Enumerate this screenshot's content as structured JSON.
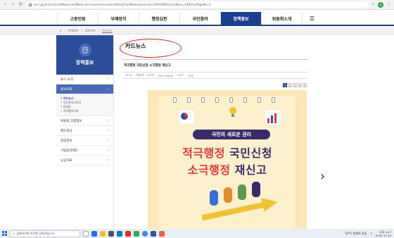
{
  "browser": {
    "url": "acrc.go.kr/acrc/cardNews/cardNews.do?command=searchDetailCardNews&menuId=050509055cardNum=1493curPageNo=1",
    "avatar_letter": "s"
  },
  "topnav": {
    "items": [
      "고충민원",
      "부패방지",
      "행정심판",
      "국민참여",
      "정책홍보",
      "위원회소개"
    ],
    "active": "정책홍보"
  },
  "breadcrumb": [
    "정책홍보",
    "홍보자료",
    "카드뉴스"
  ],
  "sidebar": {
    "title": "정책홍보",
    "rows": [
      {
        "label": "뉴스·소식",
        "active": false
      },
      {
        "label": "홍보자료",
        "active": true
      }
    ],
    "sub_items": [
      "카드뉴스",
      "국민권익스토리",
      "동영상",
      "기타홍보자료"
    ],
    "sub_active": "카드뉴스",
    "rows_after": [
      "위원회 의결정보",
      "제도개선",
      "법령정보",
      "기업윤리제도",
      "공공자료"
    ]
  },
  "content": {
    "page_title": "카드뉴스",
    "article_title": "적극행정 국민신청 소극행정 재신고",
    "meta": {
      "writer_label": "게시자",
      "writer": "박소미",
      "date_label": "게시일",
      "date": "2021-08-25",
      "views_label": "조회수",
      "views": "729"
    },
    "pages": [
      "1",
      "2",
      "3",
      "4",
      "5"
    ],
    "current_page": "1",
    "card": {
      "subtitle": "국민의 새로운 권리",
      "line1_a": "적극행정 ",
      "line1_b": "국민신청",
      "line2_a": "소극행정 ",
      "line2_b": "재신고"
    }
  },
  "taskbar": {
    "search_placeholder": "검색하려면 여기에 입력하십시오.",
    "weather": "19°C 대체로 흐림",
    "time": "오후 1:07",
    "date": "2021-11-03"
  }
}
